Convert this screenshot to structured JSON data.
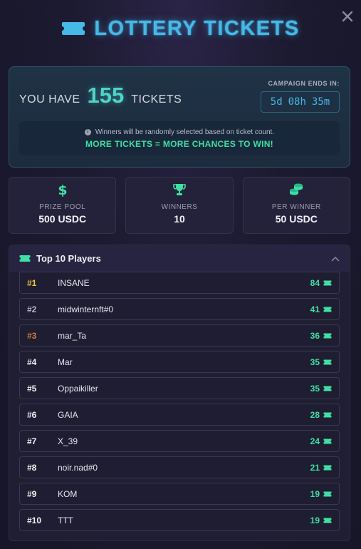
{
  "header": {
    "title": "LOTTERY TICKETS"
  },
  "hero": {
    "you_have": "YOU HAVE",
    "count": "155",
    "tickets": "TICKETS",
    "campaign_label": "CAMPAIGN ENDS IN:",
    "countdown": {
      "days": "5d",
      "hours": "08h",
      "minutes": "35m"
    },
    "info": "Winners will be randomly selected based on ticket count.",
    "highlight": "MORE TICKETS = MORE CHANCES TO WIN!"
  },
  "stats": [
    {
      "icon": "dollar-icon",
      "label": "PRIZE POOL",
      "value": "500 USDC"
    },
    {
      "icon": "trophy-icon",
      "label": "WINNERS",
      "value": "10"
    },
    {
      "icon": "coins-icon",
      "label": "PER WINNER",
      "value": "50 USDC"
    }
  ],
  "leaderboard": {
    "title": "Top 10 Players",
    "rows": [
      {
        "rank": "#1",
        "name": "INSANE",
        "score": "84"
      },
      {
        "rank": "#2",
        "name": "midwinternft#0",
        "score": "41"
      },
      {
        "rank": "#3",
        "name": "mar_Ta",
        "score": "36"
      },
      {
        "rank": "#4",
        "name": "Mar",
        "score": "35"
      },
      {
        "rank": "#5",
        "name": "Oppaikiller",
        "score": "35"
      },
      {
        "rank": "#6",
        "name": "GAIA",
        "score": "28"
      },
      {
        "rank": "#7",
        "name": "X_39",
        "score": "24"
      },
      {
        "rank": "#8",
        "name": "noir.nad#0",
        "score": "21"
      },
      {
        "rank": "#9",
        "name": "KOM",
        "score": "19"
      },
      {
        "rank": "#10",
        "name": "TTT",
        "score": "19"
      }
    ]
  },
  "colors": {
    "accent_blue": "#45b9e8",
    "accent_green": "#3ee0a4",
    "gold": "#f4c43a",
    "silver": "#b4b6c4",
    "bronze": "#d07a36"
  }
}
